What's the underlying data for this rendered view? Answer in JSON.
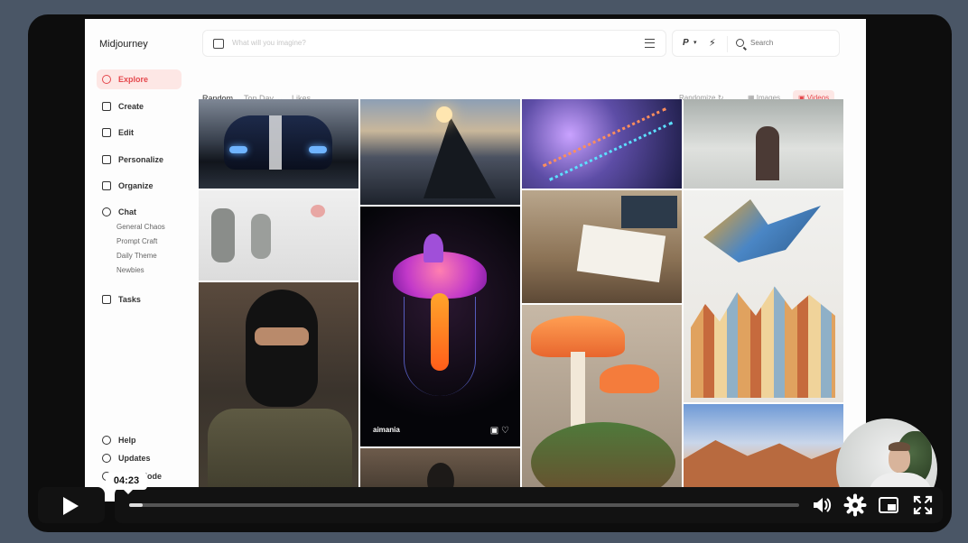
{
  "app": {
    "name": "Midjourney",
    "nav": [
      {
        "label": "Explore",
        "icon": "compass-icon",
        "active": true
      },
      {
        "label": "Create",
        "icon": "brush-icon"
      },
      {
        "label": "Edit",
        "icon": "edit-icon"
      },
      {
        "label": "Personalize",
        "icon": "palette-icon"
      },
      {
        "label": "Organize",
        "icon": "image-icon"
      },
      {
        "label": "Chat",
        "icon": "chat-icon"
      },
      {
        "label": "Tasks",
        "icon": "thumbs-up-icon"
      }
    ],
    "chat_channels": [
      "General Chaos",
      "Prompt Craft",
      "Daily Theme",
      "Newbies"
    ],
    "bottom_nav": [
      {
        "label": "Help",
        "icon": "help-icon"
      },
      {
        "label": "Updates",
        "icon": "bell-icon"
      },
      {
        "label": "Light Mode",
        "icon": "sun-icon"
      }
    ],
    "prompt_placeholder": "What will you imagine?",
    "ctrl": {
      "p_label": "P",
      "search_placeholder": "Search"
    },
    "filters": [
      "Random",
      "Top Day",
      "Likes"
    ],
    "right_filters": {
      "randomize": "Randomize",
      "images": "Images",
      "videos": "Videos"
    },
    "featured_tile": {
      "caption": "aimania"
    },
    "accent_color": "#e5484d"
  },
  "player": {
    "time_tooltip": "04:23",
    "progress": 0.02,
    "controls": [
      "play-icon",
      "volume-icon",
      "settings-icon",
      "picture-in-picture-icon",
      "fullscreen-icon"
    ]
  }
}
